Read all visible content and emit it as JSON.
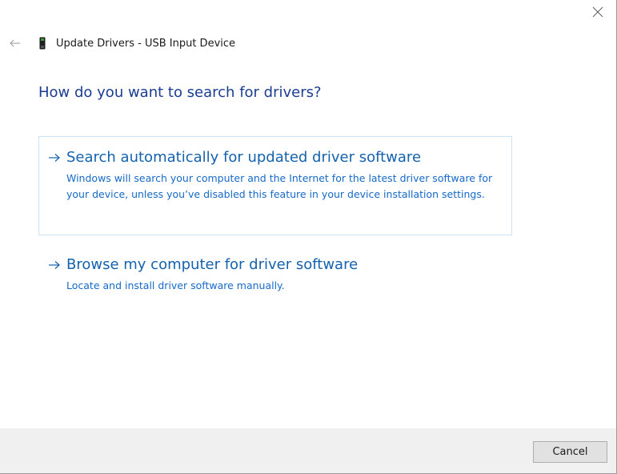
{
  "window": {
    "title": "Update Drivers - USB Input Device",
    "close_icon": "close-icon",
    "back_icon": "back-arrow-icon",
    "device_icon": "usb-device-icon"
  },
  "main": {
    "heading": "How do you want to search for drivers?",
    "options": [
      {
        "title": "Search automatically for updated driver software",
        "description": "Windows will search your computer and the Internet for the latest driver software for your device, unless you’ve disabled this feature in your device installation settings.",
        "icon": "arrow-right-icon"
      },
      {
        "title": "Browse my computer for driver software",
        "description": "Locate and install driver software manually.",
        "icon": "arrow-right-icon"
      }
    ]
  },
  "footer": {
    "cancel_label": "Cancel"
  },
  "colors": {
    "heading": "#1b3d91",
    "link": "#1462ad",
    "focus_border": "#cde3f3",
    "footer_bg": "#f0f0f0"
  }
}
